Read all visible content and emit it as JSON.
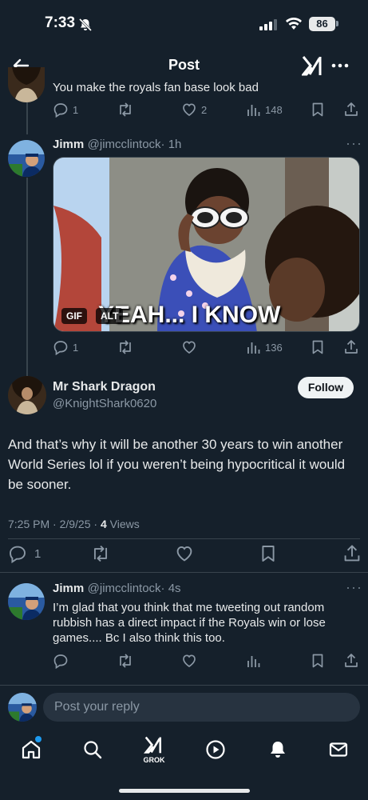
{
  "status_bar": {
    "time": "7:33",
    "battery": "86"
  },
  "header": {
    "title": "Post"
  },
  "prev_reply": {
    "text": "You make the royals fan base look bad",
    "replies": "1",
    "likes": "2",
    "views": "148"
  },
  "gif_reply": {
    "name": "Jimm",
    "handle": "@jimcclintock",
    "time": "· 1h",
    "gif_label": "GIF",
    "alt_label": "ALT",
    "gif_caption": "YEAH... I KNOW",
    "replies": "1",
    "views": "136"
  },
  "main_post": {
    "name": "Mr Shark Dragon",
    "handle": "@KnightShark0620",
    "follow_label": "Follow",
    "text": "And that’s why it will be another 30 years to win another World Series lol if you weren’t being hypocritical it would be sooner.",
    "timestamp": "7:25 PM · 2/9/25 · ",
    "views_count": "4",
    "views_label": " Views",
    "replies": "1"
  },
  "reply": {
    "name": "Jimm",
    "handle": "@jimcclintock",
    "time": "· 4s",
    "text": "I’m glad that you think that me tweeting out random rubbish has a direct impact if the Royals win or lose games.... Bc I also think this too."
  },
  "composer": {
    "placeholder": "Post your reply"
  },
  "tab_bar": {
    "grok_label": "GROK"
  },
  "colors": {
    "background": "#15202b",
    "notification_dot": "#1d9bf0"
  }
}
